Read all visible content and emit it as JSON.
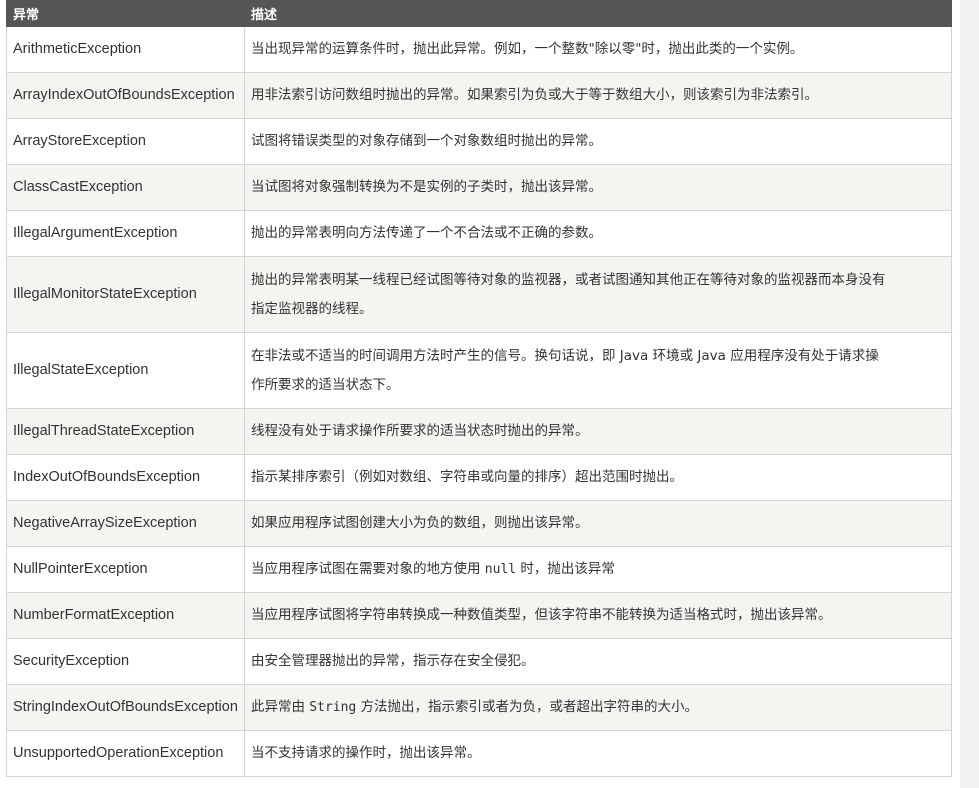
{
  "table": {
    "headers": [
      "异常",
      "描述"
    ],
    "rows": [
      {
        "name": "ArithmeticException",
        "desc": [
          "当出现异常的运算条件时，抛出此异常。例如，一个整数\"除以零\"时，抛出此类的一个实例。"
        ]
      },
      {
        "name": "ArrayIndexOutOfBoundsException",
        "desc": [
          "用非法索引访问数组时抛出的异常。如果索引为负或大于等于数组大小，则该索引为非法索引。"
        ]
      },
      {
        "name": "ArrayStoreException",
        "desc": [
          "试图将错误类型的对象存储到一个对象数组时抛出的异常。"
        ]
      },
      {
        "name": "ClassCastException",
        "desc": [
          "当试图将对象强制转换为不是实例的子类时，抛出该异常。"
        ]
      },
      {
        "name": "IllegalArgumentException",
        "desc": [
          "抛出的异常表明向方法传递了一个不合法或不正确的参数。"
        ]
      },
      {
        "name": "IllegalMonitorStateException",
        "desc": [
          "抛出的异常表明某一线程已经试图等待对象的监视器，或者试图通知其他正在等待对象的监视器而本身没有",
          "指定监视器的线程。"
        ]
      },
      {
        "name": "IllegalStateException",
        "desc": [
          "在非法或不适当的时间调用方法时产生的信号。换句话说，即 Java 环境或 Java 应用程序没有处于请求操",
          "作所要求的适当状态下。"
        ]
      },
      {
        "name": "IllegalThreadStateException",
        "desc": [
          "线程没有处于请求操作所要求的适当状态时抛出的异常。"
        ]
      },
      {
        "name": "IndexOutOfBoundsException",
        "desc": [
          "指示某排序索引（例如对数组、字符串或向量的排序）超出范围时抛出。"
        ]
      },
      {
        "name": "NegativeArraySizeException",
        "desc": [
          "如果应用程序试图创建大小为负的数组，则抛出该异常。"
        ]
      },
      {
        "name": "NullPointerException",
        "desc_parts": [
          "当应用程序试图在需要对象的地方使用 ",
          "null",
          " 时，抛出该异常"
        ]
      },
      {
        "name": "NumberFormatException",
        "desc": [
          "当应用程序试图将字符串转换成一种数值类型，但该字符串不能转换为适当格式时，抛出该异常。"
        ]
      },
      {
        "name": "SecurityException",
        "desc": [
          "由安全管理器抛出的异常，指示存在安全侵犯。"
        ]
      },
      {
        "name": "StringIndexOutOfBoundsException",
        "desc_parts": [
          "此异常由 ",
          "String",
          " 方法抛出，指示索引或者为负，或者超出字符串的大小。"
        ]
      },
      {
        "name": "UnsupportedOperationException",
        "desc": [
          "当不支持请求的操作时，抛出该异常。"
        ]
      }
    ]
  }
}
